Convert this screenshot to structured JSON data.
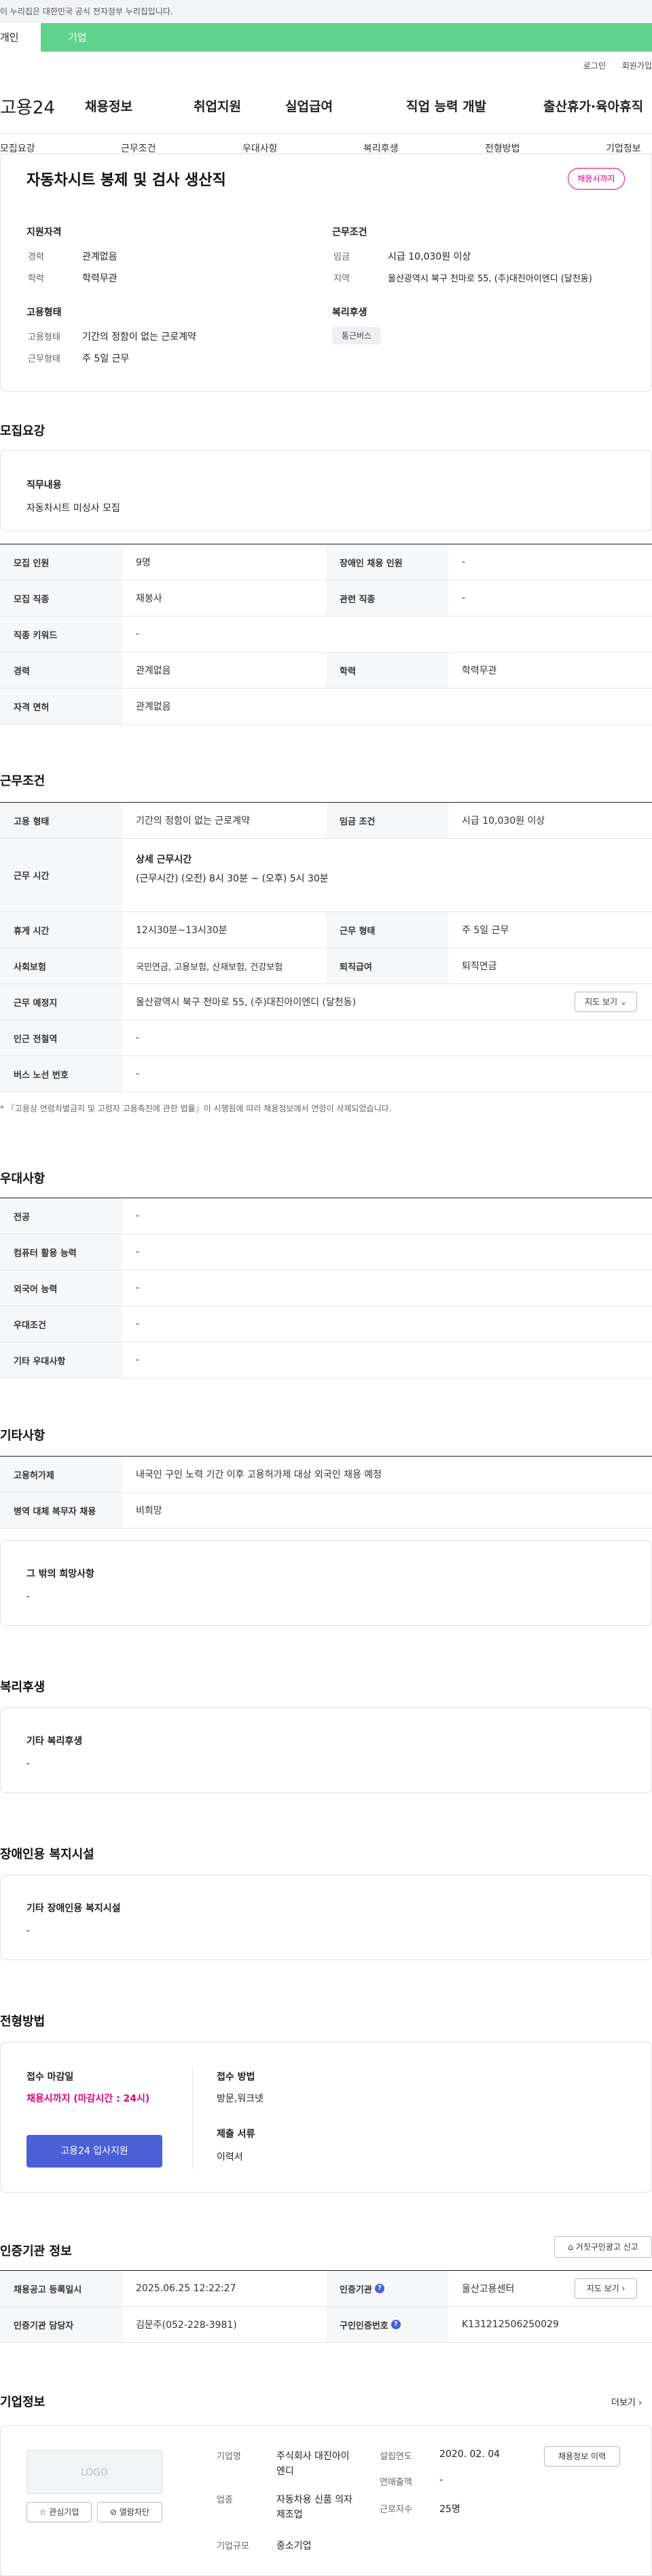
{
  "gov_banner": "이 누리집은 대한민국 공식 전자정부 누리집입니다.",
  "portal_tabs": {
    "personal": "개인",
    "company": "기업"
  },
  "util": {
    "login": "로그인",
    "signup": "회원가입"
  },
  "logo": "고용24",
  "gnb": [
    "채용정보",
    "취업지원",
    "실업급여",
    "직업 능력 개발",
    "출산휴가·육아휴직"
  ],
  "lnb": [
    "모집요강",
    "근무조건",
    "우대사항",
    "복리후생",
    "전형방법",
    "기업정보"
  ],
  "job": {
    "title": "자동차시트 봉제 및 검사 생산직",
    "status_badge": "채용시까지",
    "qual_title": "지원자격",
    "career_label": "경력",
    "career_value": "관계없음",
    "edu_label": "학력",
    "edu_value": "학력무관",
    "emp_title": "고용형태",
    "emp_type_label": "고용형태",
    "emp_type_value": "기간의 정함이 없는 근로계약",
    "work_type_label": "근무형태",
    "work_type_value": "주 5일 근무",
    "cond_title": "근무조건",
    "wage_label": "임금",
    "wage_value": "시급 10,030원 이상",
    "region_label": "지역",
    "region_value": "울산광역시 북구 천마로 55, (주)대진아이엔디 (달천동)",
    "welfare_title": "복리후생",
    "welfare_chip": "통근버스"
  },
  "recruit": {
    "heading": "모집요강",
    "duty_title": "직무내용",
    "duty_value": "자동차시트 미싱사 모집",
    "rows": [
      {
        "th1": "모집 인원",
        "td1": "9명",
        "th2": "장애인 채용 인원",
        "td2": "-"
      },
      {
        "th1": "모집 직종",
        "td1": "재봉사",
        "th2": "관련 직종",
        "td2": "-"
      },
      {
        "th1": "직종 키워드",
        "td1": "-"
      },
      {
        "th1": "경력",
        "td1": "관계없음",
        "th2": "학력",
        "td2": "학력무관"
      },
      {
        "th1": "자격 면허",
        "td1": "관계없음"
      }
    ]
  },
  "conditions": {
    "heading": "근무조건",
    "emp_type_th": "고용 형태",
    "emp_type_td": "기간의 정함이 없는 근로계약",
    "wage_th": "임금 조건",
    "wage_td": "시급 10,030원 이상",
    "hours_th": "근무 시간",
    "hours_sub": "상세 근무시간",
    "hours_td": "(근무시간) (오전) 8시 30분 ~ (오후) 5시 30분",
    "rest_th": "휴게 시간",
    "rest_td": "12시30분~13시30분",
    "form_th": "근무 형태",
    "form_td": "주 5일 근무",
    "ins_th": "사회보험",
    "ins_td": "국민연금, 고용보험, 산재보험, 건강보험",
    "retire_th": "퇴직급여",
    "retire_td": "퇴직연금",
    "place_th": "근무 예정지",
    "place_td": "울산광역시 북구 천마로 55, (주)대진아이엔디 (달천동)",
    "map_btn": "지도 보기",
    "station_th": "인근 전철역",
    "station_td": "-",
    "bus_th": "버스 노선 번호",
    "bus_td": "-",
    "note": "* 『고용상 연령차별금지 및 고령자 고용촉진에 관한 법률』이 시행됨에 따라 채용정보에서 연령이 삭제되었습니다."
  },
  "preference": {
    "heading": "우대사항",
    "rows": [
      {
        "th": "전공",
        "td": "-"
      },
      {
        "th": "컴퓨터 활용 능력",
        "td": "-"
      },
      {
        "th": "외국어 능력",
        "td": "-"
      },
      {
        "th": "우대조건",
        "td": "-"
      },
      {
        "th": "기타 우대사항",
        "td": "-"
      }
    ]
  },
  "etc": {
    "heading": "기타사항",
    "rows": [
      {
        "th": "고용허가제",
        "td": "내국인 구인 노력 기간 이후 고용허가제 대상 외국인 채용 예정"
      },
      {
        "th": "병역 대체 복무자 채용",
        "td": "비희망"
      }
    ],
    "other_title": "그 밖의 희망사항",
    "other_value": "-"
  },
  "welfare": {
    "heading": "복리후생",
    "box_title": "기타 복리후생",
    "box_value": "-"
  },
  "disability": {
    "heading": "장애인용 복지시설",
    "box_title": "기타 장애인용 복지시설",
    "box_value": "-"
  },
  "selection": {
    "heading": "전형방법",
    "deadline_title": "접수 마감일",
    "deadline_value": "채용시까지 (마감시간 : 24시)",
    "apply_btn": "고용24 입사지원",
    "method_title": "접수 방법",
    "method_value": "방문,워크넷",
    "docs_title": "제출 서류",
    "docs_value": "이력서"
  },
  "certification": {
    "heading": "인증기관 정보",
    "report_btn": "거짓구인광고 신고",
    "reg_th": "채용공고 등록일시",
    "reg_td": "2025.06.25 12:22:27",
    "agency_th": "인증기관",
    "agency_td": "울산고용센터",
    "map_btn": "지도 보기",
    "manager_th": "인증기관 담당자",
    "manager_td": "김문주(052-228-3981)",
    "cert_no_th": "구인인증번호",
    "cert_no_td": "K131212506250029"
  },
  "company": {
    "heading": "기업정보",
    "more": "더보기",
    "logo_placeholder": "LOGO",
    "fav_btn": "관심기업",
    "block_btn": "열람차단",
    "name_label": "기업명",
    "name_value": "주식회사 대진아이엔디",
    "industry_label": "업종",
    "industry_value": "자동차용 신품 의자 제조업",
    "size_label": "기업규모",
    "size_value": "중소기업",
    "founded_label": "설립연도",
    "founded_value": "2020. 02. 04",
    "sales_label": "연매출액",
    "sales_value": "-",
    "staff_label": "근로자수",
    "staff_value": "25명",
    "history_btn": "채용정보 이력"
  },
  "colors": {
    "accent_green": "#5fd38d",
    "primary_blue": "#4a5fd8",
    "deadline_pink": "#e4007f"
  }
}
